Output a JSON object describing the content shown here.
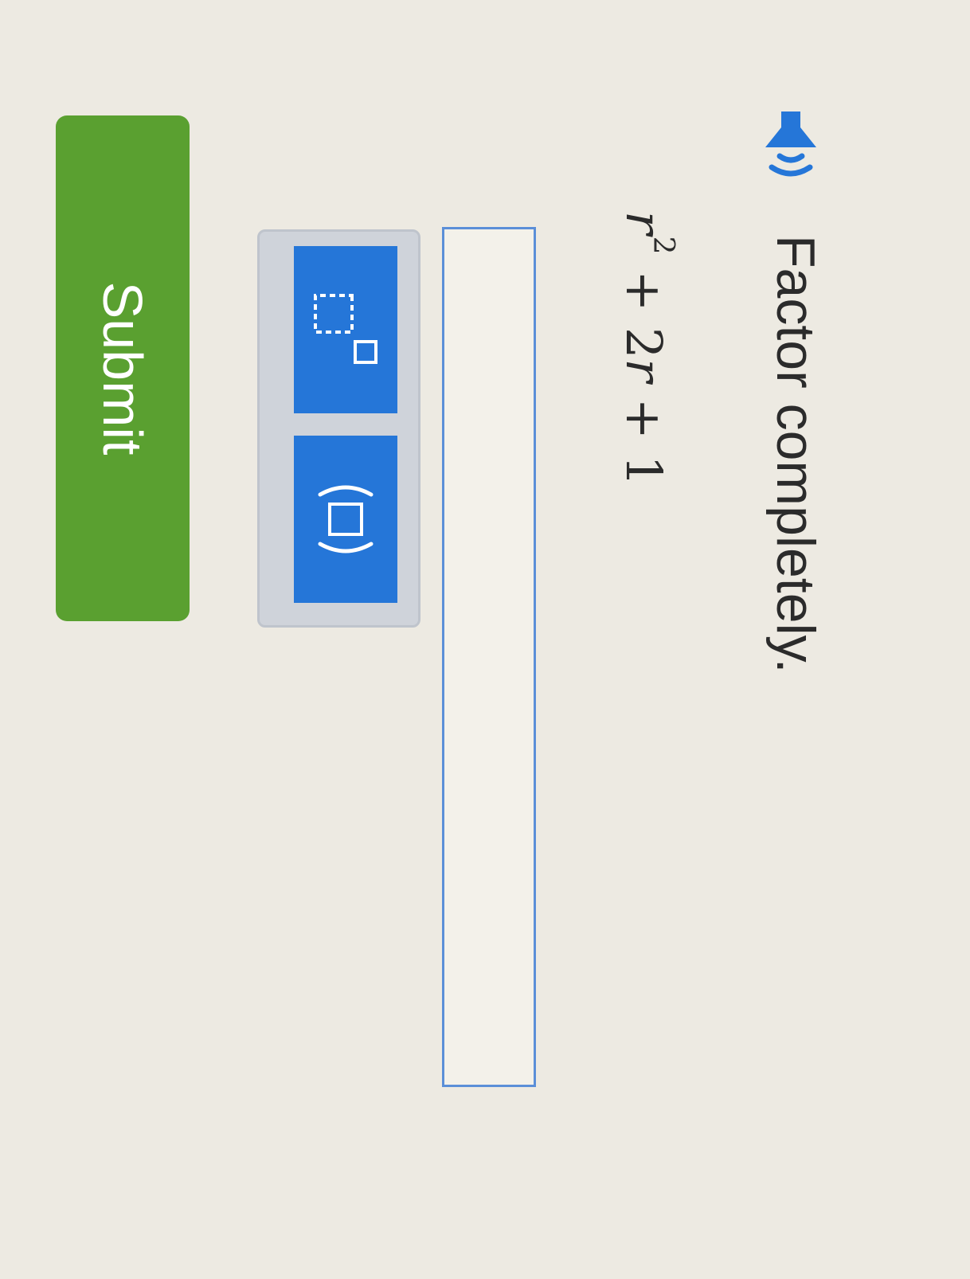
{
  "question": {
    "speaker_icon": "speaker-icon",
    "prompt": "Factor completely.",
    "expression": {
      "term1_var": "r",
      "term1_exp": "2",
      "term2": "+ 2",
      "term2_var": "r",
      "term3": "+ 1"
    }
  },
  "answer": {
    "value": ""
  },
  "palette": {
    "buttons": [
      {
        "icon": "exponent-template-icon"
      },
      {
        "icon": "parentheses-template-icon"
      }
    ]
  },
  "actions": {
    "submit_label": "Submit"
  },
  "colors": {
    "accent_blue": "#2576d8",
    "submit_green": "#5aa030",
    "input_border": "#5b8fd8"
  }
}
